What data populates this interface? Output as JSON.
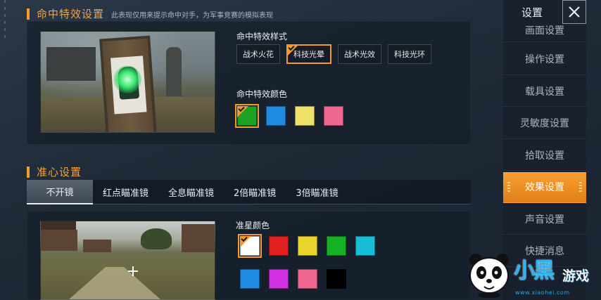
{
  "hit_effect": {
    "section_title": "命中特效设置",
    "section_note": "此表现仅用来提示命中对手，为军事竞赛的模拟表现",
    "style_label": "命中特效样式",
    "styles": [
      {
        "label": "战术火花",
        "selected": false
      },
      {
        "label": "科技光晕",
        "selected": true
      },
      {
        "label": "战术光效",
        "selected": false
      },
      {
        "label": "科技光环",
        "selected": false
      }
    ],
    "color_label": "命中特效颜色",
    "colors": [
      {
        "color": "#1aa320",
        "selected": true
      },
      {
        "color": "#1e8ae0",
        "selected": false
      },
      {
        "color": "#efe26a",
        "selected": false
      },
      {
        "color": "#f0688f",
        "selected": false
      }
    ]
  },
  "crosshair": {
    "section_title": "准心设置",
    "tabs": [
      {
        "label": "不开镜",
        "active": true
      },
      {
        "label": "红点瞄准镜",
        "active": false
      },
      {
        "label": "全息瞄准镜",
        "active": false
      },
      {
        "label": "2倍瞄准镜",
        "active": false
      },
      {
        "label": "3倍瞄准镜",
        "active": false
      }
    ],
    "color_label": "准星颜色",
    "colors": [
      {
        "color": "#ffffff",
        "selected": true
      },
      {
        "color": "#e02020",
        "selected": false
      },
      {
        "color": "#e8d42c",
        "selected": false
      },
      {
        "color": "#16b024",
        "selected": false
      },
      {
        "color": "#17bcd6",
        "selected": false
      },
      {
        "color": "#1e8ae0",
        "selected": false
      },
      {
        "color": "#d030e0",
        "selected": false
      },
      {
        "color": "#f0688f",
        "selected": false
      },
      {
        "color": "#000000",
        "selected": false
      }
    ]
  },
  "sidebar": {
    "title": "设置",
    "close_icon": "close-icon",
    "items": [
      {
        "label": "画面设置",
        "active": false
      },
      {
        "label": "操作设置",
        "active": false
      },
      {
        "label": "载具设置",
        "active": false
      },
      {
        "label": "灵敏度设置",
        "active": false
      },
      {
        "label": "拾取设置",
        "active": false
      },
      {
        "label": "效果设置",
        "active": true
      },
      {
        "label": "声音设置",
        "active": false
      },
      {
        "label": "快捷消息",
        "active": false
      }
    ]
  },
  "watermark": {
    "logo_text": "小黑",
    "logo_text_2": "游戏",
    "url": "www.xiaohei.com"
  },
  "accent_color": "#f39c2b"
}
